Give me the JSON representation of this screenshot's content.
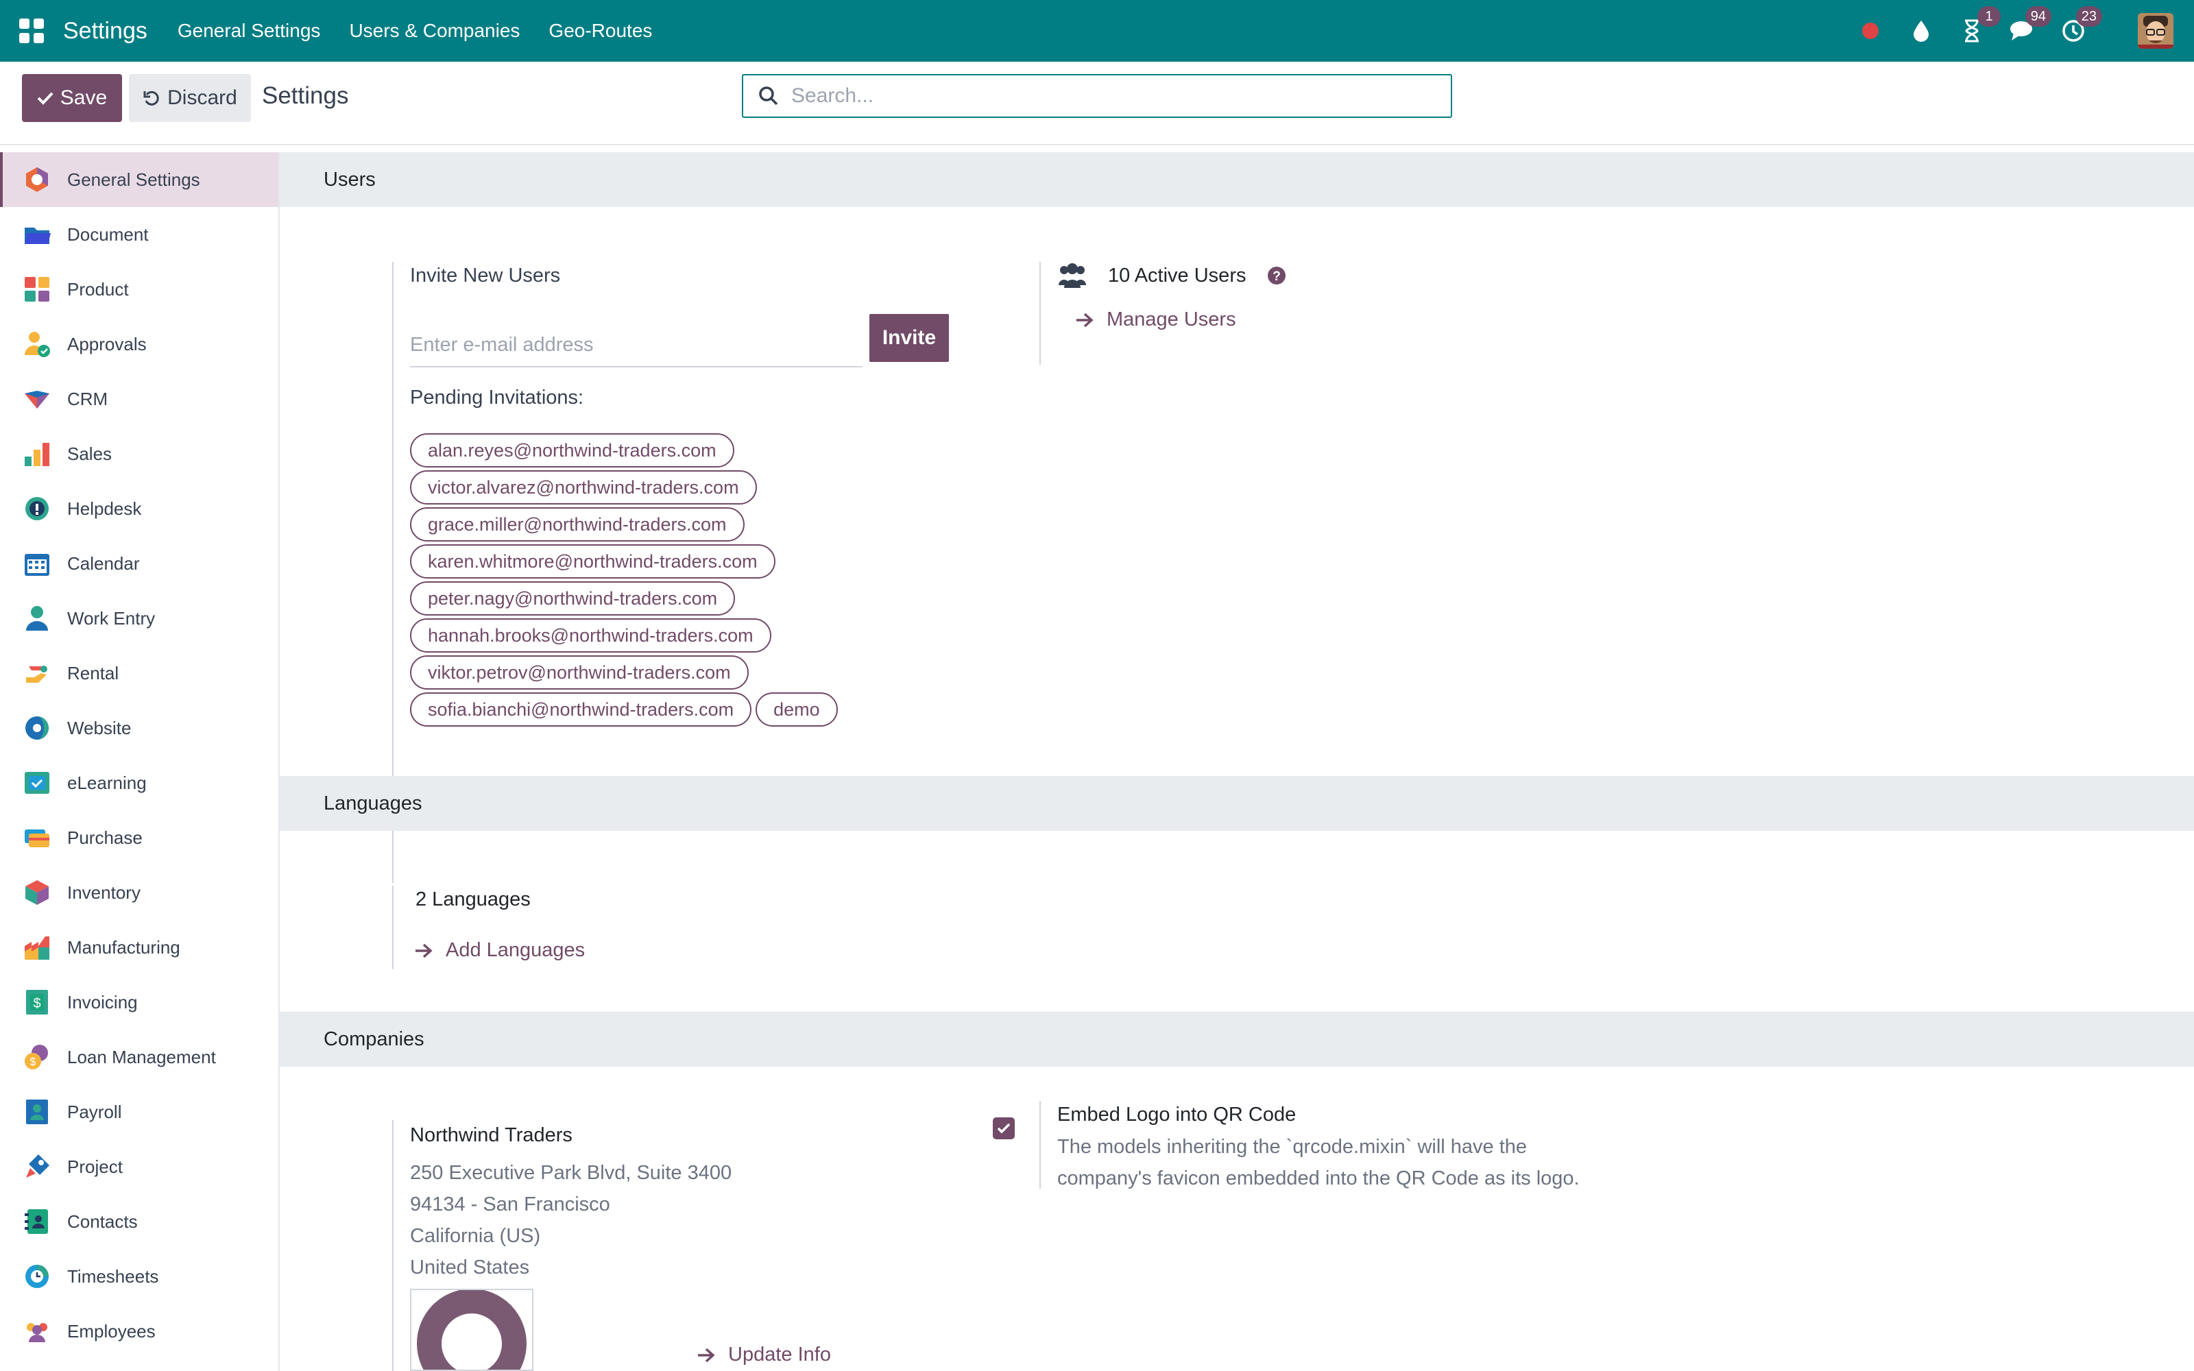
{
  "navbar": {
    "brand": "Settings",
    "menus": [
      "General Settings",
      "Users & Companies",
      "Geo-Routes"
    ],
    "activity_badge": "1",
    "messages_badge": "94",
    "timer_badge": "23",
    "bg_color": "#017e84"
  },
  "control_panel": {
    "save_label": "Save",
    "discard_label": "Discard",
    "title": "Settings",
    "search_placeholder": "Search..."
  },
  "sidebar": {
    "items": [
      {
        "label": "General Settings",
        "icon": "general-settings-icon"
      },
      {
        "label": "Document",
        "icon": "document-icon"
      },
      {
        "label": "Product",
        "icon": "product-icon"
      },
      {
        "label": "Approvals",
        "icon": "approvals-icon"
      },
      {
        "label": "CRM",
        "icon": "crm-icon"
      },
      {
        "label": "Sales",
        "icon": "sales-icon"
      },
      {
        "label": "Helpdesk",
        "icon": "helpdesk-icon"
      },
      {
        "label": "Calendar",
        "icon": "calendar-icon"
      },
      {
        "label": "Work Entry",
        "icon": "work-entry-icon"
      },
      {
        "label": "Rental",
        "icon": "rental-icon"
      },
      {
        "label": "Website",
        "icon": "website-icon"
      },
      {
        "label": "eLearning",
        "icon": "elearning-icon"
      },
      {
        "label": "Purchase",
        "icon": "purchase-icon"
      },
      {
        "label": "Inventory",
        "icon": "inventory-icon"
      },
      {
        "label": "Manufacturing",
        "icon": "manufacturing-icon"
      },
      {
        "label": "Invoicing",
        "icon": "invoicing-icon"
      },
      {
        "label": "Loan Management",
        "icon": "loan-management-icon"
      },
      {
        "label": "Payroll",
        "icon": "payroll-icon"
      },
      {
        "label": "Project",
        "icon": "project-icon"
      },
      {
        "label": "Contacts",
        "icon": "contacts-icon"
      },
      {
        "label": "Timesheets",
        "icon": "timesheets-icon"
      },
      {
        "label": "Employees",
        "icon": "employees-icon"
      }
    ]
  },
  "users": {
    "section_title": "Users",
    "invite_title": "Invite New Users",
    "email_placeholder": "Enter e-mail address",
    "invite_label": "Invite",
    "pending_title": "Pending Invitations:",
    "pending": [
      [
        "alan.reyes@northwind-traders.com"
      ],
      [
        "victor.alvarez@northwind-traders.com"
      ],
      [
        "grace.miller@northwind-traders.com"
      ],
      [
        "karen.whitmore@northwind-traders.com"
      ],
      [
        "peter.nagy@northwind-traders.com"
      ],
      [
        "hannah.brooks@northwind-traders.com"
      ],
      [
        "viktor.petrov@northwind-traders.com"
      ],
      [
        "sofia.bianchi@northwind-traders.com",
        "demo"
      ]
    ],
    "active_users": "10 Active Users",
    "manage_users": "Manage Users"
  },
  "languages": {
    "section_title": "Languages",
    "count": "2 Languages",
    "add": "Add Languages"
  },
  "companies": {
    "section_title": "Companies",
    "name": "Northwind Traders",
    "address": [
      "250 Executive Park Blvd, Suite 3400",
      "94134 - San Francisco",
      "California (US)",
      "United States"
    ],
    "update_info": "Update Info",
    "qr_title": "Embed Logo into QR Code",
    "qr_desc_1": "The models inheriting the `qrcode.mixin` will have the",
    "qr_desc_2": "company's favicon embedded into the QR Code as its logo.",
    "qr_checked": true
  },
  "colors": {
    "accent": "#714b67",
    "section_bg": "#e9ecef"
  }
}
